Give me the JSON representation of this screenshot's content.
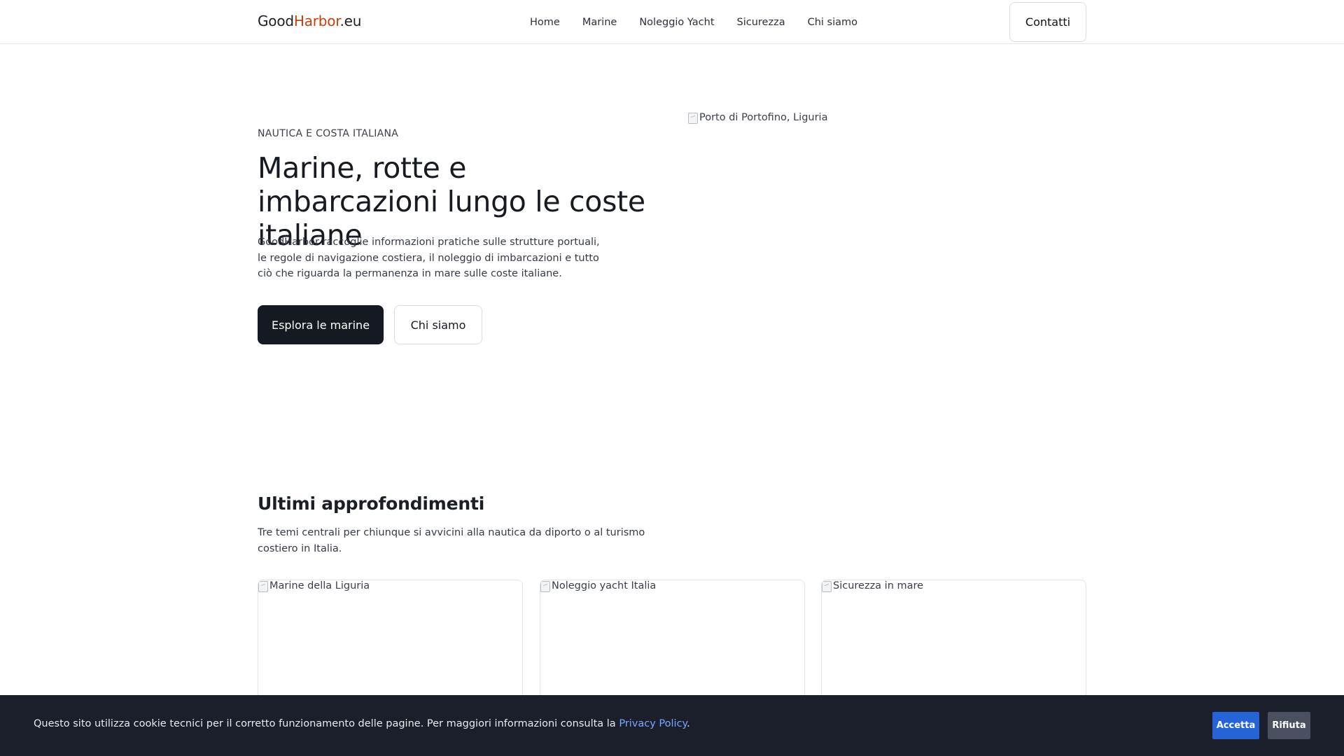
{
  "header": {
    "logo_part1": "Good",
    "logo_part2": "Harbor",
    "logo_part3": ".eu",
    "nav": [
      "Home",
      "Marine",
      "Noleggio Yacht",
      "Sicurezza",
      "Chi siamo"
    ],
    "contact_label": "Contatti"
  },
  "hero": {
    "eyebrow": "NAUTICA E COSTA ITALIANA",
    "title": "Marine, rotte e imbarcazioni lungo le coste italiane",
    "description": "GoodHarbor raccoglie informazioni pratiche sulle strutture portuali, le regole di navigazione costiera, il noleggio di imbarcazioni e tutto ciò che riguarda la permanenza in mare sulle coste italiane.",
    "primary_button": "Esplora le marine",
    "secondary_button": "Chi siamo",
    "image_alt": "Porto di Portofino, Liguria"
  },
  "section": {
    "title": "Ultimi approfondimenti",
    "description": "Tre temi centrali per chiunque si avvicini alla nautica da diporto o al turismo costiero in Italia.",
    "cards": [
      {
        "image_alt": "Marine della Liguria"
      },
      {
        "image_alt": "Noleggio yacht Italia"
      },
      {
        "image_alt": "Sicurezza in mare"
      }
    ]
  },
  "cookie": {
    "text": "Questo sito utilizza cookie tecnici per il corretto funzionamento delle pagine. Per maggiori informazioni consulta la ",
    "link": "Privacy Policy",
    "suffix": ".",
    "accept": "Accetta",
    "reject": "Rifiuta"
  },
  "colors": {
    "logo_accent": "#c2410c",
    "primary_button": "#141922",
    "cookie_bg": "#1b1f2b",
    "accept_button": "#2563d6",
    "reject_button": "#4b5060",
    "link": "#7aa7ff"
  }
}
